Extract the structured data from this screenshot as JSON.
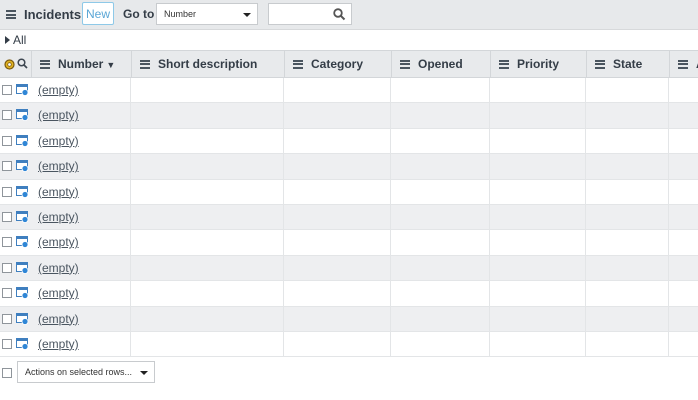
{
  "toolbar": {
    "title": "Incidents",
    "new_label": "New",
    "goto_label": "Go to",
    "goto_selected": "Number",
    "search_value": ""
  },
  "breadcrumb": {
    "label": "All"
  },
  "columns": [
    {
      "label": "Number",
      "sorted": "desc"
    },
    {
      "label": "Short description"
    },
    {
      "label": "Category"
    },
    {
      "label": "Opened"
    },
    {
      "label": "Priority"
    },
    {
      "label": "State"
    },
    {
      "label": "A"
    }
  ],
  "rows": [
    "(empty)",
    "(empty)",
    "(empty)",
    "(empty)",
    "(empty)",
    "(empty)",
    "(empty)",
    "(empty)",
    "(empty)",
    "(empty)",
    "(empty)"
  ],
  "footer": {
    "actions_label": "Actions on selected rows..."
  },
  "colors": {
    "accent": "#5aa6d6",
    "header_bg": "#e8eaec",
    "row_alt": "#eeeff1"
  }
}
